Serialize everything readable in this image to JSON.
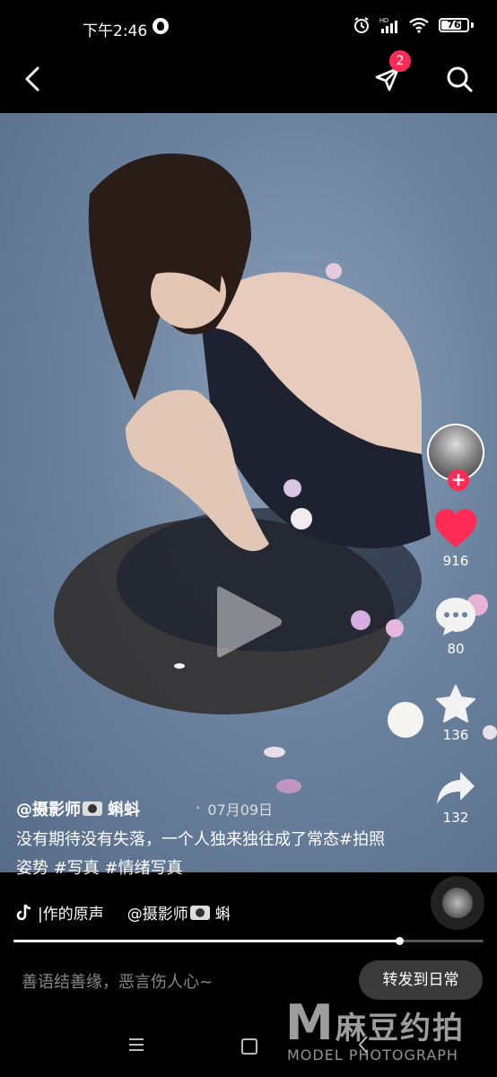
{
  "status_bar": {
    "time": "下午2:46",
    "battery": "76",
    "hd_label": "HD"
  },
  "top_nav": {
    "send_badge": "2"
  },
  "side_actions": {
    "likes": "916",
    "comments": "80",
    "favorites": "136",
    "shares": "132"
  },
  "caption": {
    "author": "@摄影师",
    "author_suffix": "蝌蚪",
    "separator": "·",
    "date": "07月09日",
    "description": "没有期待没有失落，一个人独来独往成了常态#拍照姿势 #写真 #情绪写真"
  },
  "music": {
    "title": "|作的原声",
    "author": "@摄影师",
    "author_suffix": "蝌"
  },
  "progress": {
    "fraction": 0.82
  },
  "bottom_bar": {
    "comment_placeholder": "善语结善缘，恶言伤人心~",
    "forward_label": "转发到日常"
  },
  "watermark": {
    "logo_letter": "M",
    "cn_text": "麻豆约拍",
    "en_text": "MODEL PHOTOGRAPH"
  },
  "colors": {
    "accent": "#fe2c55",
    "heart": "#fe2c55"
  },
  "icons": [
    "back-icon",
    "send-icon",
    "search-icon",
    "heart-icon",
    "comment-icon",
    "star-icon",
    "share-icon",
    "play-icon",
    "tiktok-note-icon"
  ]
}
